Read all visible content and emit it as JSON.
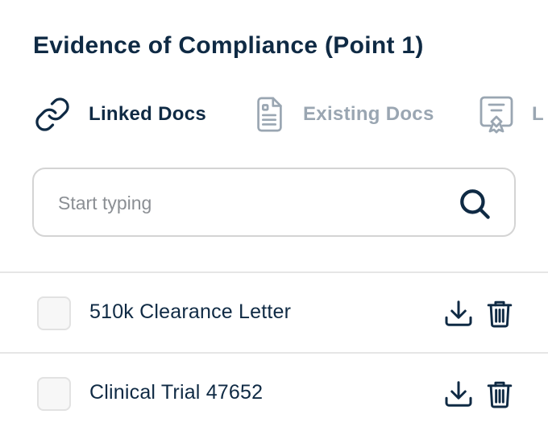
{
  "header": {
    "title": "Evidence of Compliance (Point 1)"
  },
  "tabs": [
    {
      "label": "Linked Docs",
      "icon": "link-icon",
      "active": true
    },
    {
      "label": "Existing Docs",
      "icon": "document-icon",
      "active": false
    },
    {
      "label": "L",
      "icon": "certificate-icon",
      "active": false
    }
  ],
  "search": {
    "placeholder": "Start typing",
    "value": ""
  },
  "documents": [
    {
      "name": "510k Clearance Letter",
      "checked": false
    },
    {
      "name": "Clinical Trial 47652",
      "checked": false
    }
  ],
  "colors": {
    "text": "#0f2a44",
    "muted": "#9aa6b2",
    "border": "#d4d4d4",
    "divider": "#e6e6e6"
  }
}
